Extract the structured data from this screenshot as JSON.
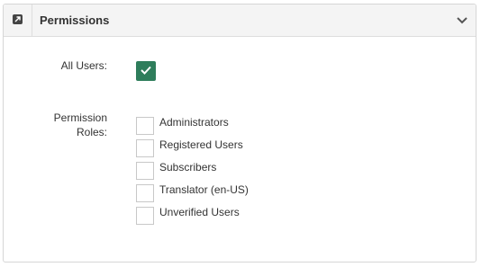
{
  "panel": {
    "title": "Permissions",
    "header_icon": "external-link-icon",
    "collapse_icon": "chevron-down-icon"
  },
  "fields": {
    "all_users_label": "All Users:",
    "all_users_checked": true,
    "roles_label_line1": "Permission",
    "roles_label_line2": "Roles:"
  },
  "roles": [
    {
      "label": "Administrators",
      "checked": false
    },
    {
      "label": "Registered Users",
      "checked": false
    },
    {
      "label": "Subscribers",
      "checked": false
    },
    {
      "label": "Translator (en-US)",
      "checked": false
    },
    {
      "label": "Unverified Users",
      "checked": false
    }
  ],
  "colors": {
    "checked": "#2e7d5b",
    "header_bg": "#f4f4f4"
  }
}
